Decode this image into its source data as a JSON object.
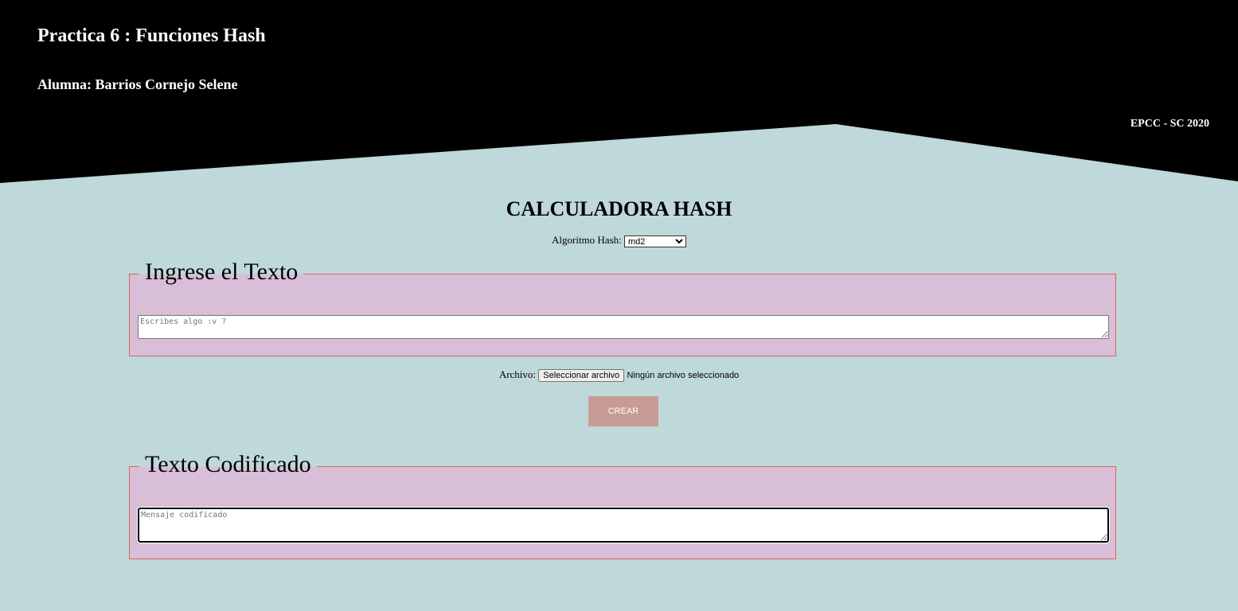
{
  "header": {
    "title": "Practica 6 : Funciones Hash",
    "student": "Alumna: Barrios Cornejo Selene",
    "org": "EPCC - SC 2020",
    "background_color": "#000000"
  },
  "calculator": {
    "title": "CALCULADORA HASH",
    "algorithm_label": "Algoritmo Hash:",
    "algorithm_selected": "md2"
  },
  "input_section": {
    "legend": "Ingrese el Texto",
    "placeholder": "Escribes algo :v ?"
  },
  "file": {
    "label": "Archivo:",
    "button_label": "Seleccionar archivo",
    "status": "Ningún archivo seleccionado"
  },
  "actions": {
    "create_label": "CREAR"
  },
  "output_section": {
    "legend": "Texto Codificado",
    "placeholder": "Mensaje codificado"
  },
  "colors": {
    "page_background": "#bfd8da",
    "fieldset_background": "#d8bed7",
    "fieldset_border": "#e06060",
    "button_background": "#c79c94"
  }
}
